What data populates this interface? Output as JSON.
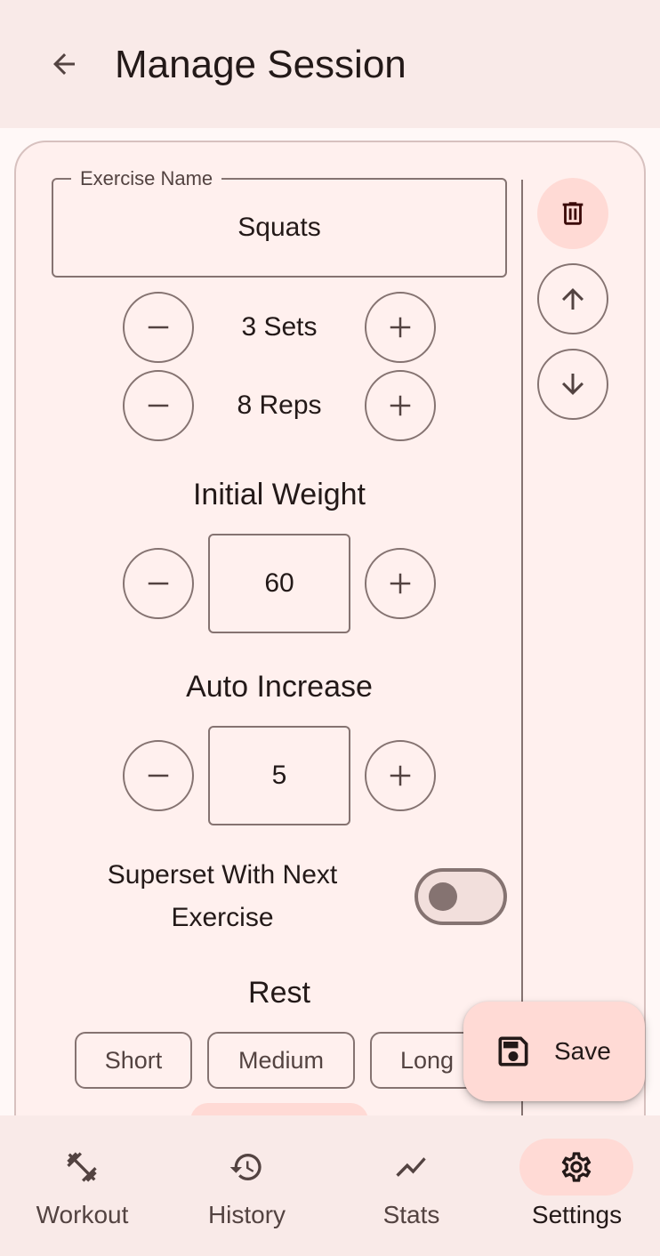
{
  "header": {
    "title": "Manage Session",
    "back_icon": "arrow-back-icon"
  },
  "exercise": {
    "name_label": "Exercise Name",
    "name_value": "Squats",
    "sets_text": "3 Sets",
    "reps_text": "8 Reps",
    "initial_weight_title": "Initial Weight",
    "initial_weight_value": "60",
    "auto_increase_title": "Auto Increase",
    "auto_increase_value": "5",
    "superset_label": "Superset With Next Exercise",
    "superset_enabled": false,
    "rest_title": "Rest",
    "rest_options": [
      "Short",
      "Medium",
      "Long"
    ]
  },
  "side_actions": {
    "delete_icon": "trash-icon",
    "move_up_icon": "arrow-up-icon",
    "move_down_icon": "arrow-down-icon"
  },
  "fab": {
    "label": "Save",
    "icon": "save-icon"
  },
  "nav": {
    "items": [
      {
        "label": "Workout",
        "icon": "dumbbell-icon",
        "active": false
      },
      {
        "label": "History",
        "icon": "history-icon",
        "active": false
      },
      {
        "label": "Stats",
        "icon": "trend-icon",
        "active": false
      },
      {
        "label": "Settings",
        "icon": "gear-icon",
        "active": true
      }
    ]
  },
  "colors": {
    "background": "#fff8f7",
    "surface": "#f9eae8",
    "accent_container": "#ffdad5",
    "outline": "#857371",
    "on_surface": "#231918"
  }
}
